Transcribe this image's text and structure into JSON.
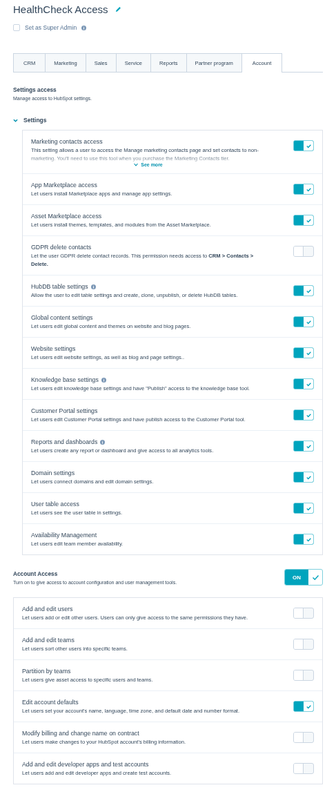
{
  "title": "HealthCheck Access",
  "super_admin": {
    "label": "Set as Super Admin",
    "checked": false
  },
  "tabs": [
    {
      "label": "CRM",
      "selected": false
    },
    {
      "label": "Marketing",
      "selected": false
    },
    {
      "label": "Sales",
      "selected": false
    },
    {
      "label": "Service",
      "selected": false
    },
    {
      "label": "Reports",
      "selected": false
    },
    {
      "label": "Partner program",
      "selected": false
    },
    {
      "label": "Account",
      "selected": true
    }
  ],
  "settings_access": {
    "title": "Settings access",
    "description": "Manage access to HubSpot settings."
  },
  "settings_group": {
    "label": "Settings",
    "expanded": true,
    "items": [
      {
        "title": "Marketing contacts access",
        "description": "This setting allows a user to access the Manage marketing contacts page and set contacts to non-marketing. You'll need to use this tool when you purchase the Marketing Contacts tier.",
        "see_more": "See more",
        "info": false,
        "on": true
      },
      {
        "title": "App Marketplace access",
        "description": "Let users install Marketplace apps and manage app settings.",
        "info": false,
        "on": true
      },
      {
        "title": "Asset Marketplace access",
        "description": "Let users install themes, templates, and modules from the Asset Marketplace.",
        "info": false,
        "on": true
      },
      {
        "title": "GDPR delete contacts",
        "description": "Let the user GDPR delete contact records. This permission needs access to **CRM > Contacts > Delete.**",
        "info": false,
        "on": false
      },
      {
        "title": "HubDB table settings",
        "description": "Allow the user to edit table settings and create, clone, unpublish, or delete HubDB tables.",
        "info": true,
        "on": true
      },
      {
        "title": "Global content settings",
        "description": "Let users edit global content and themes on website and blog pages.",
        "info": false,
        "on": true
      },
      {
        "title": "Website settings",
        "description": "Let users edit website settings, as well as blog and page settings..",
        "info": false,
        "on": true
      },
      {
        "title": "Knowledge base settings",
        "description": "Let users edit knowledge base settings and have \"Publish\" access to the knowledge base tool.",
        "info": true,
        "on": true
      },
      {
        "title": "Customer Portal settings",
        "description": "Let users edit Customer Portal settings and have publish access to the Customer Portal tool.",
        "info": false,
        "on": true
      },
      {
        "title": "Reports and dashboards",
        "description": "Let users create any report or dashboard and give access to all analytics tools.",
        "info": true,
        "on": true
      },
      {
        "title": "Domain settings",
        "description": "Let users connect domains and edit domain settings.",
        "info": false,
        "on": true
      },
      {
        "title": "User table access",
        "description": "Let users see the user table in settings.",
        "info": false,
        "on": true
      },
      {
        "title": "Availability Management",
        "description": "Let users edit team member availability.",
        "info": false,
        "on": true
      }
    ]
  },
  "account_access": {
    "title": "Account Access",
    "description": "Turn on to give access to account configuration and user management tools.",
    "toggle": {
      "label": "ON",
      "on": true
    }
  },
  "account_items": [
    {
      "title": "Add and edit users",
      "description": "Let users add or edit other users. Users can only give access to the same permissions they have.",
      "on": false
    },
    {
      "title": "Add and edit teams",
      "description": "Let users sort other users into specific teams.",
      "on": false
    },
    {
      "title": "Partition by teams",
      "description": "Let users give asset access to specific users and teams.",
      "on": false
    },
    {
      "title": "Edit account defaults",
      "description": "Let users set your account's name, language, time zone, and default date and number format.",
      "on": true
    },
    {
      "title": "Modify billing and change name on contract",
      "description": "Let users make changes to your HubSpot account's billing information.",
      "on": false
    },
    {
      "title": "Add and edit developer apps and test accounts",
      "description": "Let users add and edit developer apps and create test accounts.",
      "on": false
    }
  ]
}
